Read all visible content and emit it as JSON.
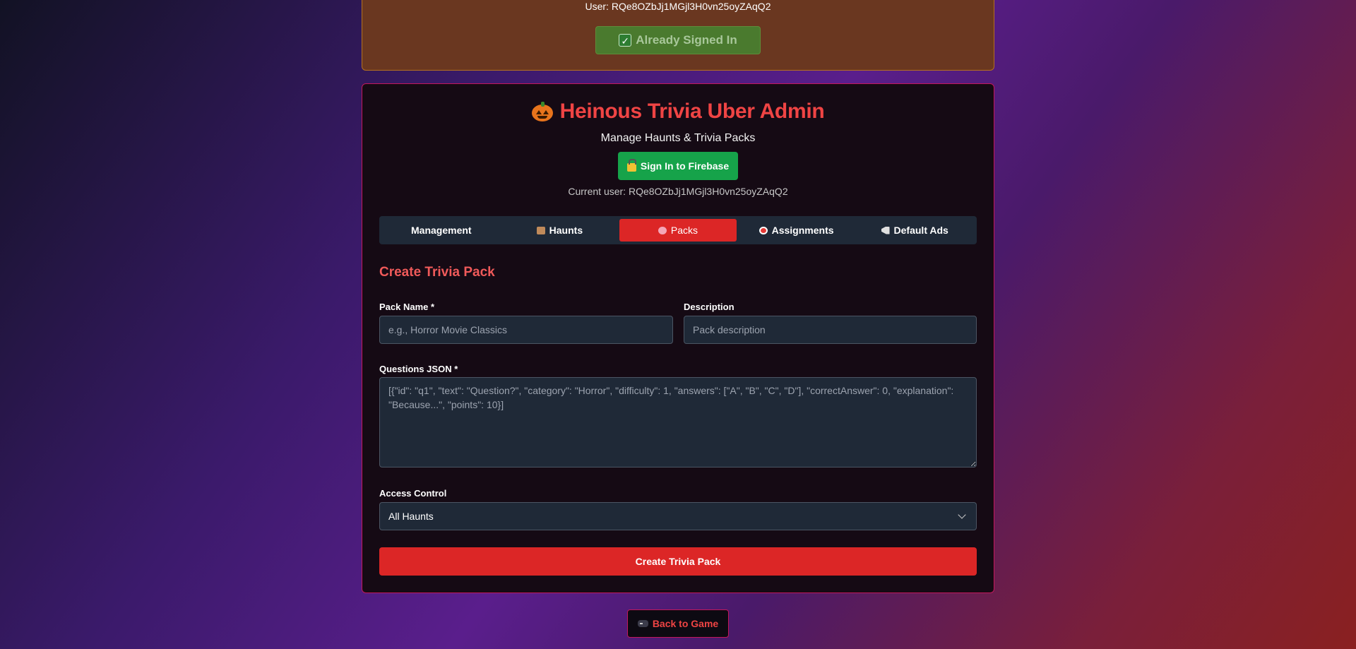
{
  "top_card": {
    "user_text": "User: RQe8OZbJj1MGjl3H0vn25oyZAqQ2",
    "signed_in_label": "Already Signed In"
  },
  "header": {
    "title": "Heinous Trivia Uber Admin",
    "subtitle": "Manage Haunts & Trivia Packs",
    "firebase_button": "Sign In to Firebase",
    "current_user": "Current user: RQe8OZbJj1MGjl3H0vn25oyZAqQ2"
  },
  "tabs": [
    {
      "label": "Management"
    },
    {
      "label": "Haunts"
    },
    {
      "label": "Packs"
    },
    {
      "label": "Assignments"
    },
    {
      "label": "Default Ads"
    }
  ],
  "form": {
    "section_title": "Create Trivia Pack",
    "pack_name_label": "Pack Name *",
    "pack_name_placeholder": "e.g., Horror Movie Classics",
    "description_label": "Description",
    "description_placeholder": "Pack description",
    "questions_label": "Questions JSON *",
    "questions_placeholder": "[{\"id\": \"q1\", \"text\": \"Question?\", \"category\": \"Horror\", \"difficulty\": 1, \"answers\": [\"A\", \"B\", \"C\", \"D\"], \"correctAnswer\": 0, \"explanation\": \"Because...\", \"points\": 10}]",
    "access_label": "Access Control",
    "access_value": "All Haunts",
    "create_button": "Create Trivia Pack"
  },
  "footer": {
    "back_button": "Back to Game"
  },
  "colors": {
    "accent_red": "#dc2626",
    "title_red": "#ef4444",
    "firebase_green": "#16a34a"
  }
}
